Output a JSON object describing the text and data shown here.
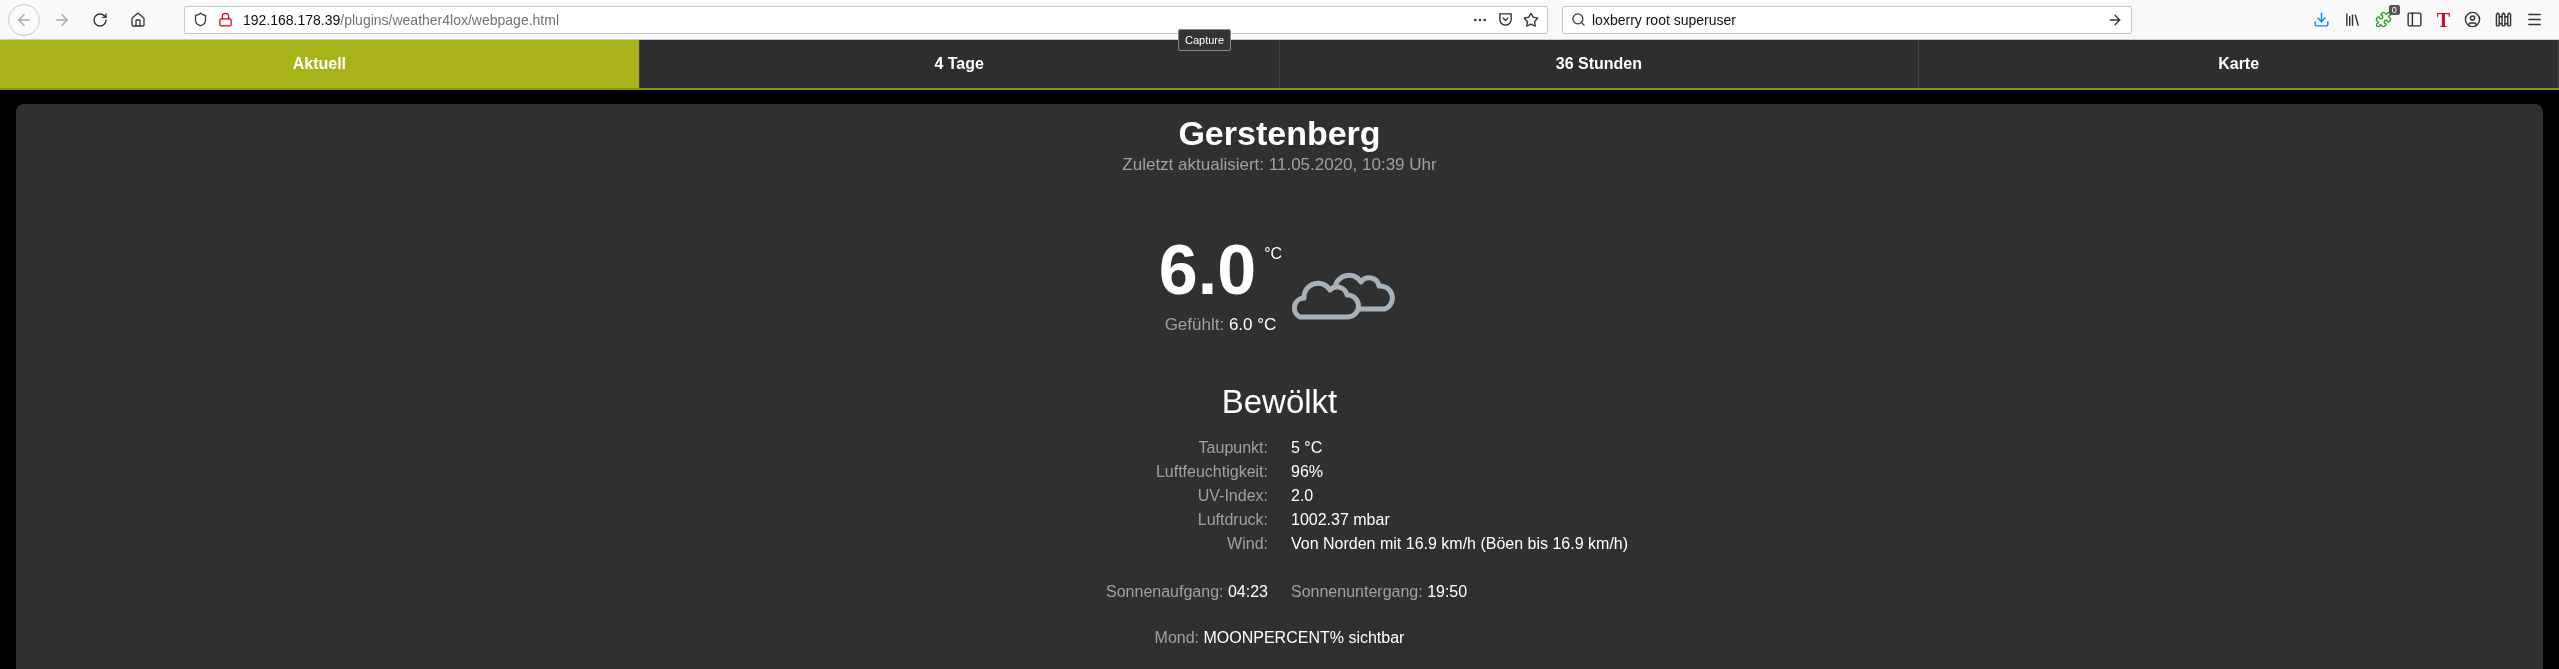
{
  "browser": {
    "url": {
      "host": "192.168.178.39",
      "path": "/plugins/weather4lox/webpage.html"
    },
    "search": {
      "value": "loxberry root superuser"
    },
    "extension_badge": "0",
    "extension_letter": "T",
    "tooltip": "Capture"
  },
  "tabs": [
    {
      "label": "Aktuell",
      "selected": true
    },
    {
      "label": "4 Tage",
      "selected": false
    },
    {
      "label": "36 Stunden",
      "selected": false
    },
    {
      "label": "Karte",
      "selected": false
    }
  ],
  "location": "Gerstenberg",
  "updated": "Zuletzt aktualisiert: 11.05.2020, 10:39 Uhr",
  "temperature": {
    "value": "6.0",
    "unit": "°C",
    "feels_label": "Gefühlt:",
    "feels_value": "6.0 °C"
  },
  "condition": "Bewölkt",
  "details": [
    {
      "label": "Taupunkt:",
      "value": "5 °C"
    },
    {
      "label": "Luftfeuchtigkeit:",
      "value": "96%"
    },
    {
      "label": "UV-Index:",
      "value": "2.0"
    },
    {
      "label": "Luftdruck:",
      "value": "1002.37 mbar"
    },
    {
      "label": "Wind:",
      "value": "Von Norden mit 16.9 km/h (Böen bis 16.9 km/h)"
    }
  ],
  "sun": [
    {
      "label": "Sonnenaufgang:",
      "value": "04:23"
    },
    {
      "label": "Sonnenuntergang:",
      "value": "19:50"
    }
  ],
  "moon": {
    "label": "Mond:",
    "value": "MOONPERCENT% sichtbar"
  }
}
